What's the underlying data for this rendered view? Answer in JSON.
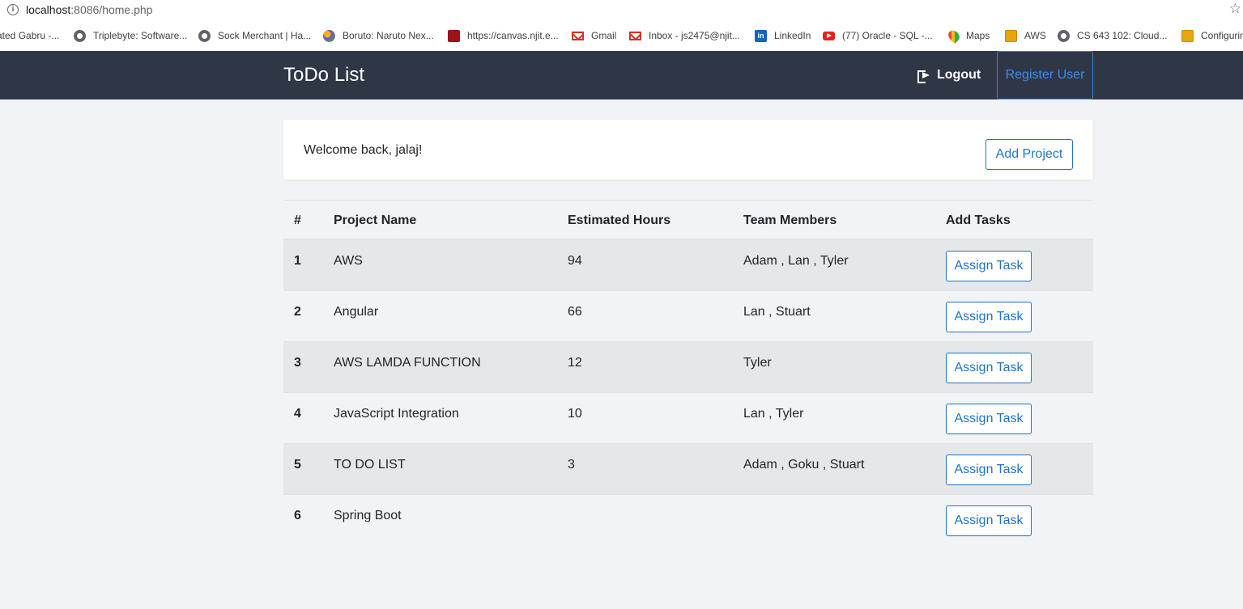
{
  "browser": {
    "url_host": "localhost",
    "url_path": ":8086/home.php",
    "info_icon": "info-icon",
    "star_icon": "star-icon",
    "bookmarks": [
      {
        "label": "ated Gabru -...",
        "icon": "none"
      },
      {
        "label": "Triplebyte: Software...",
        "icon": "globe-icon"
      },
      {
        "label": "Sock Merchant | Ha...",
        "icon": "globe-icon"
      },
      {
        "label": "Boruto: Naruto Nex...",
        "icon": "boruto-icon"
      },
      {
        "label": "https://canvas.njit.e...",
        "icon": "canvas-icon"
      },
      {
        "label": "Gmail",
        "icon": "gmail-icon"
      },
      {
        "label": "Inbox - js2475@njit...",
        "icon": "gmail-icon"
      },
      {
        "label": "LinkedIn",
        "icon": "linkedin-icon"
      },
      {
        "label": "(77) Oracle - SQL -...",
        "icon": "youtube-icon"
      },
      {
        "label": "Maps",
        "icon": "maps-icon"
      },
      {
        "label": "AWS",
        "icon": "box-icon"
      },
      {
        "label": "CS 643 102: Cloud...",
        "icon": "globe-icon"
      },
      {
        "label": "Configurin",
        "icon": "box-icon"
      }
    ]
  },
  "navbar": {
    "brand": "ToDo List",
    "logout_label": "Logout",
    "register_label": "Register User"
  },
  "welcome": {
    "message": "Welcome back, jalaj!",
    "add_project_label": "Add Project"
  },
  "table": {
    "headers": [
      "#",
      "Project Name",
      "Estimated Hours",
      "Team Members",
      "Add Tasks"
    ],
    "rows": [
      {
        "num": "1",
        "name": "AWS",
        "hours": "94",
        "members": "Adam , Lan , Tyler",
        "action": "Assign Task"
      },
      {
        "num": "2",
        "name": "Angular",
        "hours": "66",
        "members": "Lan , Stuart",
        "action": "Assign Task"
      },
      {
        "num": "3",
        "name": "AWS LAMDA FUNCTION",
        "hours": "12",
        "members": "Tyler",
        "action": "Assign Task"
      },
      {
        "num": "4",
        "name": "JavaScript Integration",
        "hours": "10",
        "members": "Lan , Tyler",
        "action": "Assign Task"
      },
      {
        "num": "5",
        "name": "TO DO LIST",
        "hours": "3",
        "members": "Adam , Goku , Stuart",
        "action": "Assign Task"
      },
      {
        "num": "6",
        "name": "Spring Boot",
        "hours": "",
        "members": "",
        "action": "Assign Task"
      }
    ]
  },
  "colors": {
    "navbar_bg": "#2f3747",
    "page_bg": "#f1f3f6",
    "accent": "#1f73c7",
    "stripe": "#e5e7e9"
  }
}
